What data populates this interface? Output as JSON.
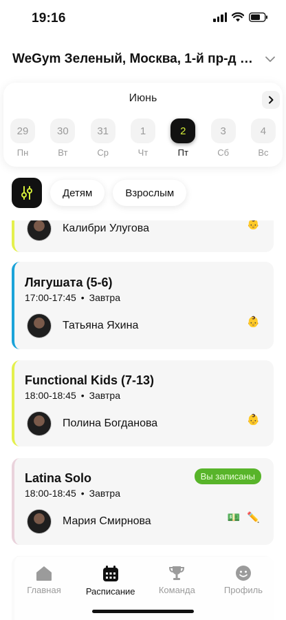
{
  "status": {
    "time": "19:16"
  },
  "header": {
    "gym_title": "WeGym Зеленый, Москва, 1-й пр-д П..."
  },
  "calendar": {
    "month": "Июнь",
    "days": [
      {
        "num": "29",
        "weekday": "Пн"
      },
      {
        "num": "30",
        "weekday": "Вт"
      },
      {
        "num": "31",
        "weekday": "Ср"
      },
      {
        "num": "1",
        "weekday": "Чт"
      },
      {
        "num": "2",
        "weekday": "Пт",
        "selected": true
      },
      {
        "num": "3",
        "weekday": "Сб"
      },
      {
        "num": "4",
        "weekday": "Вс"
      }
    ],
    "accent_color": "#d5ee3a"
  },
  "filters": {
    "chips": [
      "Детям",
      "Взрослым"
    ]
  },
  "classes": [
    {
      "title": "",
      "time": "",
      "day": "",
      "trainer": "Калибри Улугова",
      "accent": "#e4f04d",
      "icon": "baby-icon"
    },
    {
      "title": "Лягушата (5-6)",
      "time": "17:00-17:45",
      "day": "Завтра",
      "trainer": "Татьяна Яхина",
      "accent": "#1aa3d9",
      "icon": "baby-icon"
    },
    {
      "title": "Functional Kids (7-13)",
      "time": "18:00-18:45",
      "day": "Завтра",
      "trainer": "Полина Богданова",
      "accent": "#e4f04d",
      "icon": "baby-icon"
    },
    {
      "title": "Latina Solo",
      "time": "18:00-18:45",
      "day": "Завтра",
      "trainer": "Мария Смирнова",
      "accent": "#ead3dc",
      "badge": "Вы записаны",
      "icons": [
        "money-icon",
        "pencil-icon"
      ]
    }
  ],
  "tabbar": {
    "tabs": [
      {
        "label": "Главная",
        "icon": "home-icon"
      },
      {
        "label": "Расписание",
        "icon": "calendar-icon",
        "active": true
      },
      {
        "label": "Команда",
        "icon": "trophy-icon"
      },
      {
        "label": "Профиль",
        "icon": "profile-icon"
      }
    ]
  }
}
